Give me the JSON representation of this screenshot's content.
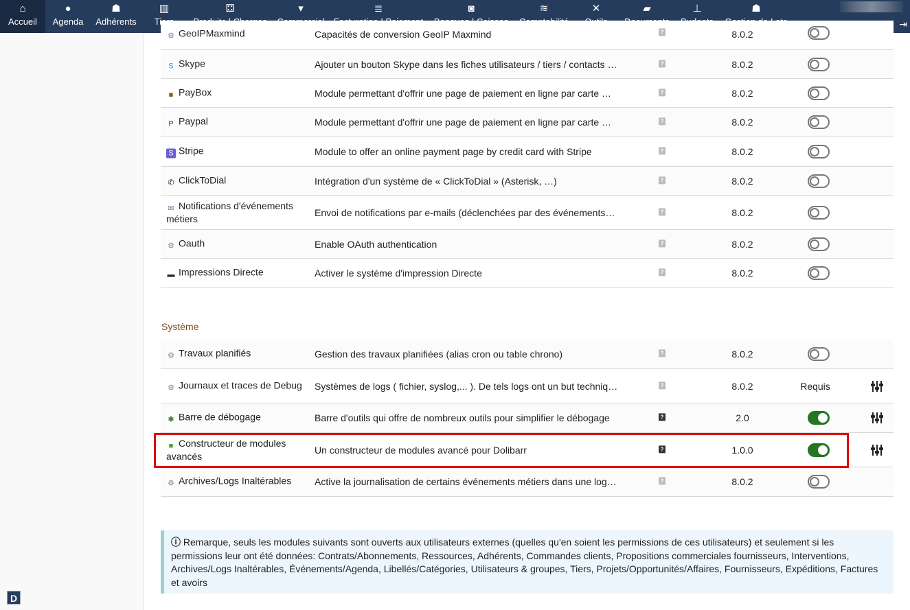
{
  "menu": [
    {
      "label": "Accueil",
      "icon": "home-icon",
      "glyph": "⌂"
    },
    {
      "label": "Agenda",
      "icon": "agenda-icon",
      "glyph": "●"
    },
    {
      "label": "Adhérents",
      "icon": "members-icon",
      "glyph": "☗"
    },
    {
      "label": "Tiers",
      "icon": "building-icon",
      "glyph": "▥"
    },
    {
      "label": "Produits | Charges",
      "icon": "cubes-icon",
      "glyph": "⚃"
    },
    {
      "label": "Commercial",
      "icon": "tie-icon",
      "glyph": "▾"
    },
    {
      "label": "Facturation | Paiement",
      "icon": "money-icon",
      "glyph": "≣"
    },
    {
      "label": "Banques | Caisses",
      "icon": "safe-icon",
      "glyph": "◙"
    },
    {
      "label": "Comptabilité",
      "icon": "coins-icon",
      "glyph": "≋"
    },
    {
      "label": "Outils",
      "icon": "tools-icon",
      "glyph": "✕"
    },
    {
      "label": "Documents",
      "icon": "folder-icon",
      "glyph": "▰"
    },
    {
      "label": "Budgets",
      "icon": "sitemap-icon",
      "glyph": "⊥"
    },
    {
      "label": "Gestion de Lots",
      "icon": "users-icon",
      "glyph": "☗"
    }
  ],
  "top_right_icons": [
    "globe-icon",
    "rocket-icon",
    "print-icon",
    "logout-icon"
  ],
  "modules_top": [
    {
      "name": "Skype",
      "icon": "skype-icon",
      "glyph": "S",
      "desc": "Ajouter un bouton Skype dans les fiches utilisateurs / tiers / contacts …",
      "version": "8.0.2",
      "enabled": false
    },
    {
      "name": "PayBox",
      "icon": "paybox-icon",
      "glyph": "■",
      "desc": "Module permettant d'offrir une page de paiement en ligne par carte …",
      "version": "8.0.2",
      "enabled": false
    },
    {
      "name": "Paypal",
      "icon": "paypal-icon",
      "glyph": "P",
      "desc": "Module permettant d'offrir une page de paiement en ligne par carte …",
      "version": "8.0.2",
      "enabled": false
    },
    {
      "name": "Stripe",
      "icon": "stripe-icon",
      "glyph": "S",
      "desc": "Module to offer an online payment page by credit card with Stripe",
      "version": "8.0.2",
      "enabled": false
    },
    {
      "name": "ClickToDial",
      "icon": "phone-icon",
      "glyph": "✆",
      "desc": "Intégration d'un système de « ClickToDial » (Asterisk, …)",
      "version": "8.0.2",
      "enabled": false
    },
    {
      "name": "Notifications d'événements métiers",
      "icon": "notification-icon",
      "glyph": "✉",
      "desc": "Envoi de notifications par e-mails (déclenchées par des événements…",
      "version": "8.0.2",
      "enabled": false
    },
    {
      "name": "Oauth",
      "icon": "gear-icon",
      "glyph": "⚙",
      "desc": "Enable OAuth authentication",
      "version": "8.0.2",
      "enabled": false
    },
    {
      "name": "Impressions Directe",
      "icon": "printer-icon",
      "glyph": "▬",
      "desc": "Activer le système d'impression Directe",
      "version": "8.0.2",
      "enabled": false
    }
  ],
  "section_title": "Système",
  "modules_system": [
    {
      "name": "Travaux planifiés",
      "icon": "gear-icon",
      "glyph": "⚙",
      "desc": "Gestion des travaux planifiées (alias cron ou table chrono)",
      "version": "8.0.2",
      "enabled": false,
      "required": "",
      "setup": false
    },
    {
      "name": "Journaux et traces de Debug",
      "icon": "gear-icon",
      "glyph": "⚙",
      "desc": "Systèmes de logs ( fichier, syslog,... ). De tels logs ont un but techniq…",
      "version": "8.0.2",
      "enabled": false,
      "required": "Requis",
      "setup": true
    },
    {
      "name": "Barre de débogage",
      "icon": "bug-icon",
      "glyph": "✱",
      "desc": "Barre d'outils qui offre de nombreux outils pour simplifier le débogage",
      "version": "2.0",
      "enabled": true,
      "required": "",
      "setup": true
    },
    {
      "name": "Constructeur de modules avancés",
      "icon": "cube-icon",
      "glyph": "■",
      "desc": "Un constructeur de modules avancé pour Dolibarr",
      "version": "1.0.0",
      "enabled": true,
      "required": "",
      "setup": true
    },
    {
      "name": "Archives/Logs Inaltérables",
      "icon": "gear-icon",
      "glyph": "⚙",
      "desc": "Active la journalisation de certains événements métiers dans une log…",
      "version": "8.0.2",
      "enabled": false,
      "required": "",
      "setup": false
    }
  ],
  "partial_row": {
    "name": "GeoIPMaxmind",
    "desc": "Capacités de conversion GeoIP Maxmind"
  },
  "note_text": "Remarque, seuls les modules suivants sont ouverts aux utilisateurs externes (quelles qu'en soient les permissions de ces utilisateurs) et seulement si les permissions leur ont été données: Contrats/Abonnements, Ressources, Adhérents, Commandes clients, Propositions commerciales fournisseurs, Interventions, Archives/Logs Inaltérables, Événements/Agenda, Libellés/Catégories, Utilisateurs & groupes, Tiers, Projets/Opportunités/Affaires, Fournisseurs, Expéditions, Factures et avoirs",
  "logo_letter": "D",
  "colors": {
    "menu_bg": "#263c5c",
    "toggle_on": "#227722",
    "highlight": "#e00000",
    "section_title": "#7a4d1f"
  }
}
